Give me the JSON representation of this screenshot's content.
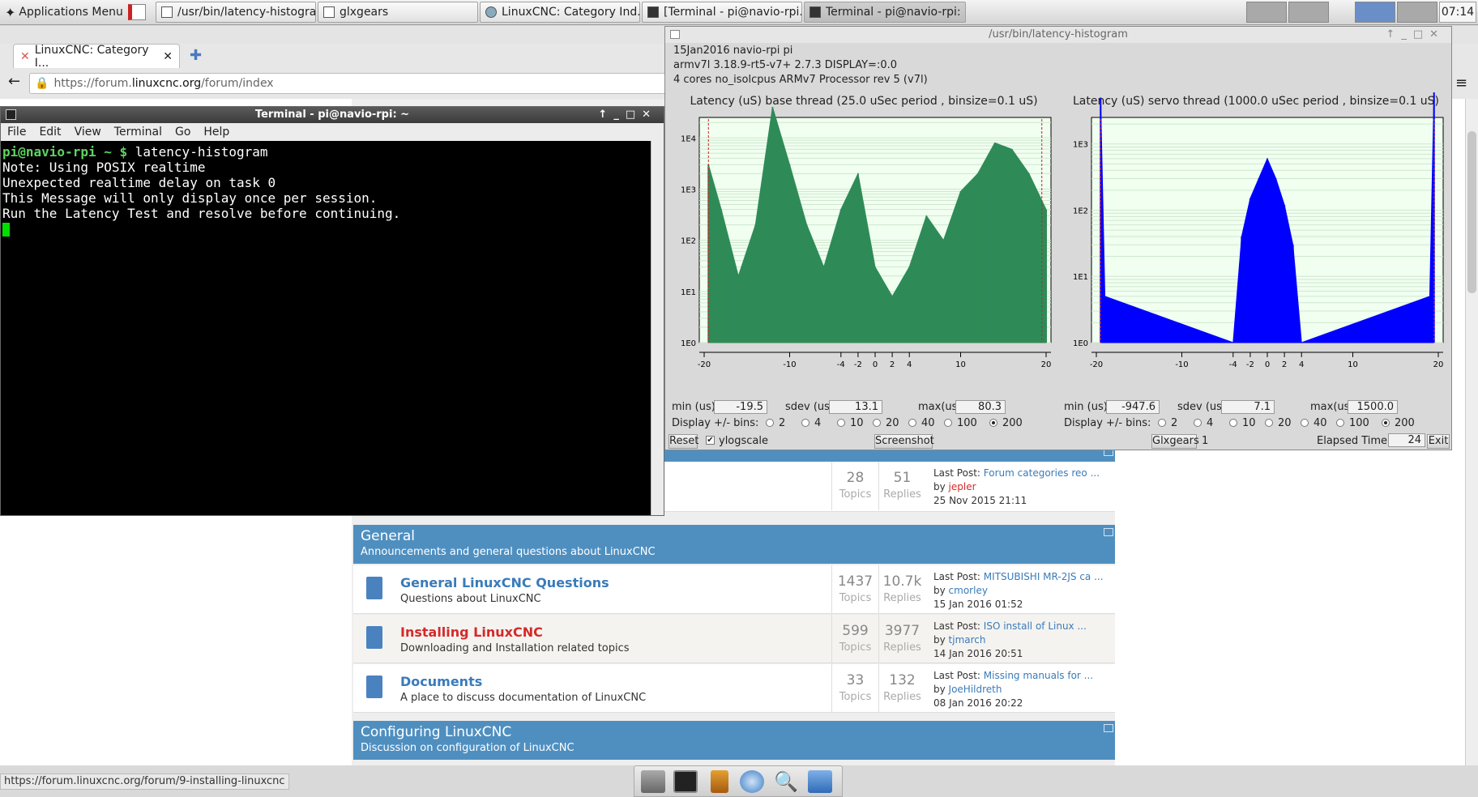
{
  "panel": {
    "app_menu": "Applications Menu",
    "tasks": [
      "/usr/bin/latency-histogram",
      "glxgears",
      "LinuxCNC: Category Ind...",
      "[Terminal - pi@navio-rpi...",
      "Terminal - pi@navio-rpi: ~"
    ],
    "clock": "07:14"
  },
  "browser": {
    "title": "LinuxCNC",
    "tab": "LinuxCNC: Category I...",
    "url_prefix": "https://forum.",
    "url_domain": "linuxcnc.org",
    "url_path": "/forum/index",
    "status_url": "https://forum.linuxcnc.org/forum/9-installing-linuxcnc"
  },
  "forum": {
    "top_row": {
      "topics": "28",
      "replies": "51",
      "lp_label": "Last Post:",
      "lp_title": "Forum categories reo ...",
      "by": "by",
      "user": "jepler",
      "date": "25 Nov 2015 21:11"
    },
    "categories": [
      {
        "title": "General",
        "subtitle": "Announcements and general questions about LinuxCNC"
      },
      {
        "title": "Configuring LinuxCNC",
        "subtitle": "Discussion on configuration of LinuxCNC"
      }
    ],
    "labels": {
      "topics": "Topics",
      "replies": "Replies",
      "last_post": "Last Post:",
      "by": "by"
    },
    "rows": [
      {
        "title": "General LinuxCNC Questions",
        "desc": "Questions about LinuxCNC",
        "topics": "1437",
        "replies": "10.7k",
        "lp_title": "MITSUBISHI MR-2JS ca ...",
        "user": "cmorley",
        "date": "15 Jan 2016 01:52"
      },
      {
        "title": "Installing LinuxCNC",
        "desc": "Downloading and Installation related topics",
        "topics": "599",
        "replies": "3977",
        "lp_title": "ISO install of Linux ...",
        "user": "tjmarch",
        "date": "14 Jan 2016 20:51"
      },
      {
        "title": "Documents",
        "desc": "A place to discuss documentation of LinuxCNC",
        "topics": "33",
        "replies": "132",
        "lp_title": "Missing manuals for ...",
        "user": "JoeHildreth",
        "date": "08 Jan 2016 20:22"
      }
    ]
  },
  "terminal": {
    "title": "Terminal - pi@navio-rpi: ~",
    "menu": [
      "File",
      "Edit",
      "View",
      "Terminal",
      "Go",
      "Help"
    ],
    "prompt": "pi@navio-rpi ~ $",
    "command": " latency-histogram",
    "lines": [
      "Note: Using POSIX realtime",
      "Unexpected realtime delay on task 0",
      "This Message will only display once per session.",
      "Run the Latency Test and resolve before continuing."
    ]
  },
  "histogram": {
    "title": "/usr/bin/latency-histogram",
    "info": [
      "15Jan2016 navio-rpi pi",
      "armv7l  3.18.9-rt5-v7+  2.7.3  DISPLAY=:0.0",
      "4 cores  no_isolcpus    ARMv7 Processor rev 5 (v7l)"
    ],
    "labels": {
      "min": "min (us)",
      "sdev": "sdev (us):",
      "max": "max(us):",
      "display": "Display +/- bins:"
    },
    "bin_options": [
      "2",
      "4",
      "10",
      "20",
      "40",
      "100",
      "200"
    ],
    "buttons": {
      "reset": "Reset",
      "ylog": "ylogscale",
      "screenshot": "Screenshot",
      "glxgears": "Glxgears",
      "glx_count": "1",
      "elapsed_label": "Elapsed Time:",
      "elapsed": "24",
      "exit": "Exit"
    },
    "colors": {
      "base": "#2e8b57",
      "servo": "#0000ff",
      "plot_bg": "#f0fff0"
    }
  },
  "chart_data": [
    {
      "type": "bar",
      "title": "Latency (uS) base thread (25.0 uSec period , binsize=0.1 uS)",
      "x_ticks": [
        "-20",
        "-10",
        "-4",
        "-2",
        "0",
        "2",
        "4",
        "10",
        "20"
      ],
      "y_ticks": [
        "1E0",
        "1E1",
        "1E2",
        "1E3",
        "1E4"
      ],
      "yscale": "log",
      "xlim": [
        -20,
        20
      ],
      "x": [
        -19.5,
        -18,
        -16,
        -14,
        -12,
        -10,
        -8,
        -6,
        -4,
        -2,
        0,
        2,
        4,
        6,
        8,
        10,
        12,
        14,
        16,
        18,
        20
      ],
      "values": [
        3000,
        400,
        20,
        200,
        40000,
        3000,
        200,
        30,
        400,
        2000,
        30,
        8,
        30,
        300,
        100,
        900,
        2000,
        8000,
        6000,
        2000,
        400
      ],
      "stats": {
        "min": "-19.5",
        "sdev": "13.1",
        "max": "80.3"
      },
      "bins_selected": "200"
    },
    {
      "type": "bar",
      "title": "Latency (uS) servo thread (1000.0 uSec period , binsize=0.1 uS)",
      "x_ticks": [
        "-20",
        "-10",
        "-4",
        "-2",
        "0",
        "2",
        "4",
        "10",
        "20"
      ],
      "y_ticks": [
        "1E0",
        "1E1",
        "1E2",
        "1E3"
      ],
      "yscale": "log",
      "xlim": [
        -20,
        20
      ],
      "x": [
        -19.5,
        -19,
        -4,
        -3,
        -2,
        -1,
        0,
        1,
        2,
        3,
        4,
        19,
        19.5
      ],
      "values": [
        5000,
        5,
        1,
        40,
        150,
        300,
        600,
        300,
        120,
        30,
        1,
        5,
        6000
      ],
      "stats": {
        "min": "-947.6",
        "sdev": "7.1",
        "max": "1500.0"
      },
      "bins_selected": "200"
    }
  ]
}
